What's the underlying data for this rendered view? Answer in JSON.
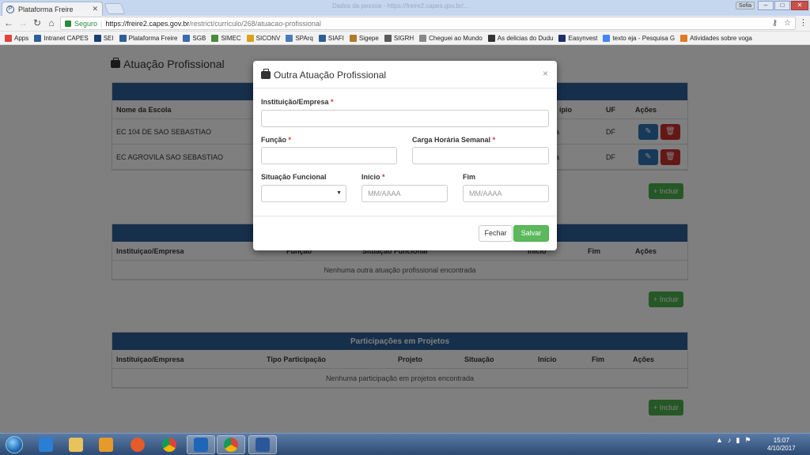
{
  "browser": {
    "tab_title": "Plataforma Freire",
    "window_title": "Dados da pessoa - https://freire2.capes.gov.br/...",
    "user_badge": "Sofia",
    "secure_label": "Seguro",
    "url_host": "https://freire2.capes.gov.br",
    "url_path": "/restrict/curriculo/268/atuacao-profissional"
  },
  "bookmarks": [
    {
      "label": "Apps",
      "color": "#e0443a"
    },
    {
      "label": "Intranet CAPES",
      "color": "#2d5f96"
    },
    {
      "label": "SEI",
      "color": "#1c3d75"
    },
    {
      "label": "Plataforma Freire",
      "color": "#2d5f96"
    },
    {
      "label": "SGB",
      "color": "#3b6cab"
    },
    {
      "label": "SIMEC",
      "color": "#4a8a3c"
    },
    {
      "label": "SICONV",
      "color": "#d8a21e"
    },
    {
      "label": "SPArq",
      "color": "#4a7bb8"
    },
    {
      "label": "SIAFI",
      "color": "#2d5f96"
    },
    {
      "label": "Sigepe",
      "color": "#b07a2a"
    },
    {
      "label": "SIGRH",
      "color": "#5a5a5a"
    },
    {
      "label": "Cheguei ao Mundo",
      "color": "#888888"
    },
    {
      "label": "As delicias do Dudu",
      "color": "#333333"
    },
    {
      "label": "Easynvest",
      "color": "#1c2d6b"
    },
    {
      "label": "texto eja - Pesquisa G",
      "color": "#4285f4"
    },
    {
      "label": "Atividades sobre voga",
      "color": "#e07a1e"
    }
  ],
  "page": {
    "title": "Atuação Profissional",
    "panel1": {
      "headers": [
        "Nome da Escola",
        "ípio",
        "UF",
        "Ações"
      ],
      "rows": [
        {
          "escola": "EC 104 DE SAO SEBASTIAO",
          "municipio": "a",
          "uf": "DF"
        },
        {
          "escola": "EC AGROVILA SAO SEBASTIAO",
          "municipio": "a",
          "uf": "DF"
        }
      ],
      "add_label": "+ Incluir"
    },
    "panel2": {
      "headers": [
        "Instituiçao/Empresa",
        "Função",
        "Situação Funcional",
        "Início",
        "Fim",
        "Ações"
      ],
      "empty": "Nenhuma outra atuação profissional encontrada",
      "add_label": "+ Incluir"
    },
    "panel3": {
      "title": "Participações em Projetos",
      "headers": [
        "Instituiçao/Empresa",
        "Tipo Participação",
        "Projeto",
        "Situação",
        "Início",
        "Fim",
        "Ações"
      ],
      "empty": "Nenhuma participação em projetos encontrada",
      "add_label": "+ Incluir"
    }
  },
  "modal": {
    "title": "Outra Atuação Profissional",
    "close": "×",
    "fields": {
      "instituicao": {
        "label": "Instituição/Empresa",
        "value": ""
      },
      "funcao": {
        "label": "Função",
        "value": ""
      },
      "carga": {
        "label": "Carga Horária Semanal",
        "value": ""
      },
      "situacao": {
        "label": "Situação Funcional",
        "value": ""
      },
      "inicio": {
        "label": "Início",
        "placeholder": "MM/AAAA"
      },
      "fim": {
        "label": "Fim",
        "placeholder": "MM/AAAA"
      }
    },
    "required_mark": "*",
    "btn_fechar": "Fechar",
    "btn_salvar": "Salvar"
  },
  "taskbar": {
    "time": "15:07",
    "date": "4/10/2017"
  }
}
